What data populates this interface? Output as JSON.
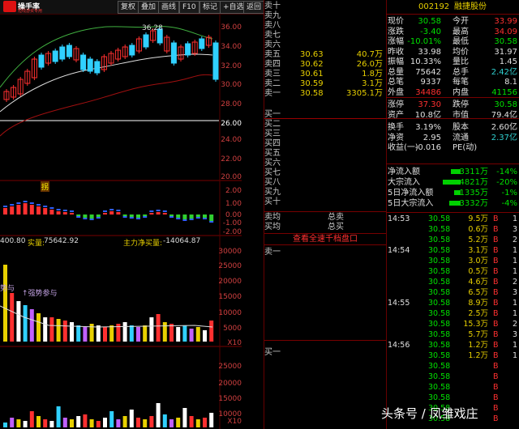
{
  "toolbar": {
    "logo_name": "操手率",
    "logo_sub": "短线游资专用",
    "buttons": [
      "复权",
      "叠加",
      "画线",
      "F10",
      "标记",
      "+自选",
      "返回"
    ]
  },
  "kchart": {
    "top_label": "36.28",
    "price_ticks": [
      "36.00",
      "34.00",
      "32.00",
      "30.00",
      "28.00",
      "26.00",
      "24.00",
      "22.00",
      "20.00"
    ],
    "reference_price": "24.00",
    "marker": "拐"
  },
  "mid_ticks": [
    "2.00",
    "1.00",
    "0.00",
    "-1.00",
    "-2.00"
  ],
  "volume_info": {
    "left": "400.80",
    "real_buy_label": "实量:",
    "real_buy": "75642.92",
    "main_net_label": "主力净买量:",
    "main_net": "-14064.87",
    "ticks": [
      "30000",
      "25000",
      "20000",
      "15000",
      "10000",
      "5000"
    ],
    "unit": "X10",
    "tag1": "势与",
    "tag2": "↑强势参与"
  },
  "lower_ticks": [
    "25000",
    "20000",
    "15000",
    "10000",
    "5000"
  ],
  "lower_unit": "X10",
  "orderbook": {
    "sell_labels": [
      "卖十",
      "卖九",
      "卖八",
      "卖七",
      "卖六",
      "卖五",
      "卖四",
      "卖三",
      "卖二",
      "卖一"
    ],
    "sells": [
      {
        "price": "",
        "vol": ""
      },
      {
        "price": "",
        "vol": ""
      },
      {
        "price": "",
        "vol": ""
      },
      {
        "price": "",
        "vol": ""
      },
      {
        "price": "",
        "vol": ""
      },
      {
        "price": "30.63",
        "vol": "40.7万"
      },
      {
        "price": "30.62",
        "vol": "26.0万"
      },
      {
        "price": "30.61",
        "vol": "1.8万"
      },
      {
        "price": "30.59",
        "vol": "3.1万"
      },
      {
        "price": "30.58",
        "vol": "3305.1万"
      }
    ],
    "buy_labels": [
      "买一",
      "买二",
      "买三",
      "买四",
      "买五",
      "买六",
      "买七",
      "买八",
      "买九",
      "买十"
    ],
    "avg_sell_label": "卖均",
    "avg_buy_label": "买均",
    "total_sell_label": "总卖",
    "total_buy_label": "总买",
    "view_all": "查看全速千档盘口",
    "sell1_bottom": "卖一",
    "buy1_bottom": "买一"
  },
  "panel": {
    "code": "002192",
    "name": "融捷股份",
    "stats": [
      [
        "现价",
        "30.58",
        "今开",
        "33.99"
      ],
      [
        "涨跌",
        "-3.40",
        "最高",
        "34.09"
      ],
      [
        "涨幅",
        "-10.01%",
        "最低",
        "30.58"
      ],
      [
        "昨收",
        "33.98",
        "均价",
        "31.97"
      ],
      [
        "振幅",
        "10.33%",
        "量比",
        "1.45"
      ],
      [
        "总量",
        "75642",
        "总手",
        "2.42亿"
      ],
      [
        "总笔",
        "9337",
        "每笔",
        "8.1"
      ],
      [
        "外盘",
        "34486",
        "内盘",
        "41156"
      ],
      [
        "涨停",
        "37.30",
        "跌停",
        "30.58"
      ],
      [
        "资产",
        "10.8亿",
        "市值",
        "79.4亿"
      ],
      [
        "换手",
        "3.19%",
        "股本",
        "2.60亿"
      ],
      [
        "净资",
        "2.95",
        "流通",
        "2.37亿"
      ],
      [
        "收益(一)",
        "-0.016",
        "PE(动)",
        ""
      ]
    ],
    "flows": [
      [
        "净流入额",
        "-3311万",
        "-14%"
      ],
      [
        "大宗流入",
        "-4821万",
        "-20%"
      ],
      [
        "5日净流入额",
        "-1335万",
        "-1%"
      ],
      [
        "5日大宗流入",
        "-3332万",
        "-4%"
      ]
    ],
    "ticks": [
      [
        "14:53",
        "30.58",
        "9.5万",
        "B",
        "1"
      ],
      [
        "",
        "30.58",
        "0.6万",
        "B",
        "3"
      ],
      [
        "",
        "30.58",
        "5.2万",
        "B",
        "2"
      ],
      [
        "14:54",
        "30.58",
        "3.1万",
        "B",
        "1"
      ],
      [
        "",
        "30.58",
        "3.0万",
        "B",
        "1"
      ],
      [
        "",
        "30.58",
        "0.5万",
        "B",
        "1"
      ],
      [
        "",
        "30.58",
        "4.6万",
        "B",
        "2"
      ],
      [
        "",
        "30.58",
        "6.5万",
        "B",
        "3"
      ],
      [
        "14:55",
        "30.58",
        "8.9万",
        "B",
        "1"
      ],
      [
        "",
        "30.58",
        "2.5万",
        "B",
        "1"
      ],
      [
        "",
        "30.58",
        "15.3万",
        "B",
        "2"
      ],
      [
        "",
        "30.58",
        "5.7万",
        "B",
        "3"
      ],
      [
        "14:56",
        "30.58",
        "1.2万",
        "B",
        "1"
      ],
      [
        "",
        "30.58",
        "1.2万",
        "B",
        "1"
      ],
      [
        "",
        "30.58",
        "",
        "B",
        ""
      ],
      [
        "",
        "30.58",
        "",
        "B",
        ""
      ],
      [
        "",
        "30.58",
        "",
        "B",
        ""
      ],
      [
        "",
        "30.58",
        "",
        "B",
        ""
      ],
      [
        "",
        "30.58",
        "",
        "B",
        ""
      ],
      [
        "",
        "30.58",
        "",
        "B",
        ""
      ]
    ]
  },
  "watermark": "头条号 / 凤雏戏庄"
}
